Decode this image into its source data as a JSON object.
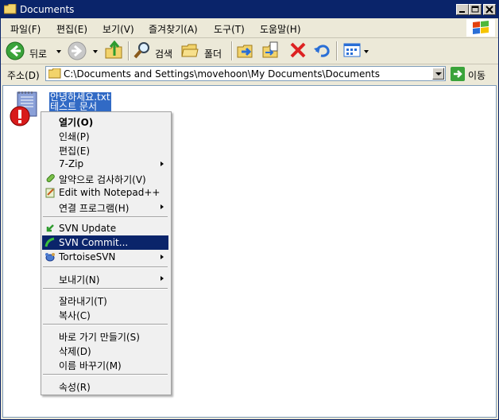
{
  "window": {
    "title": "Documents"
  },
  "menu": [
    "파일(F)",
    "편집(E)",
    "보기(V)",
    "즐겨찾기(A)",
    "도구(T)",
    "도움말(H)"
  ],
  "toolbar": {
    "back_label": "뒤로",
    "search_label": "검색",
    "folders_label": "폴더"
  },
  "address": {
    "label": "주소(D)",
    "path": "C:\\Documents and Settings\\movehoon\\My Documents\\Documents",
    "go_label": "이동"
  },
  "file": {
    "name_line1": "안녕하세요.txt",
    "name_line2": "테스트 문서"
  },
  "context_menu": {
    "open": "열기(O)",
    "print": "인쇄(P)",
    "edit": "편집(E)",
    "zip": "7-Zip",
    "scan": "알약으로 검사하기(V)",
    "notepad": "Edit with Notepad++",
    "open_with": "연결 프로그램(H)",
    "svn_update": "SVN Update",
    "svn_commit": "SVN Commit...",
    "tortoise": "TortoiseSVN",
    "send_to": "보내기(N)",
    "cut": "잘라내기(T)",
    "copy": "복사(C)",
    "shortcut": "바로 가기 만들기(S)",
    "delete": "삭제(D)",
    "rename": "이름 바꾸기(M)",
    "properties": "속성(R)"
  }
}
